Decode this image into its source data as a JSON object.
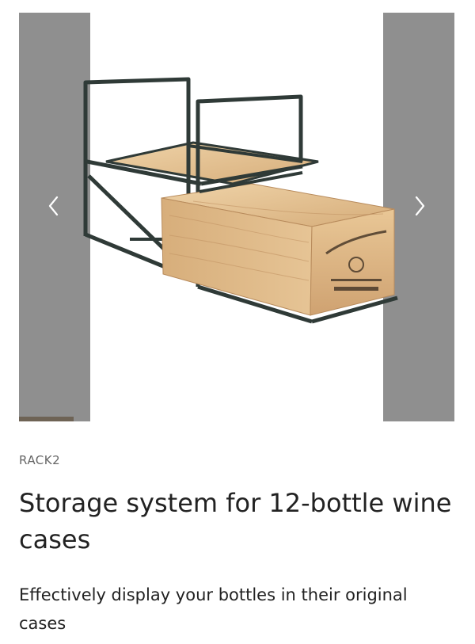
{
  "gallery": {
    "prev_icon": "chevron-left-icon",
    "next_icon": "chevron-right-icon",
    "panel_color": "#8f8f8f",
    "progress_color": "#6e6355",
    "progress_fraction": 0.125,
    "image_alt": "Wine rack with storage shelf and wooden wine case"
  },
  "product": {
    "sku": "RACK2",
    "title": "Storage system for 12-bottle wine cases",
    "subtitle": "Effectively display your bottles in their original cases"
  },
  "colors": {
    "text": "#222222",
    "muted": "#666666",
    "frame": "#2f3a37",
    "wood_light": "#e7c69a",
    "wood_dark": "#c9a170"
  }
}
